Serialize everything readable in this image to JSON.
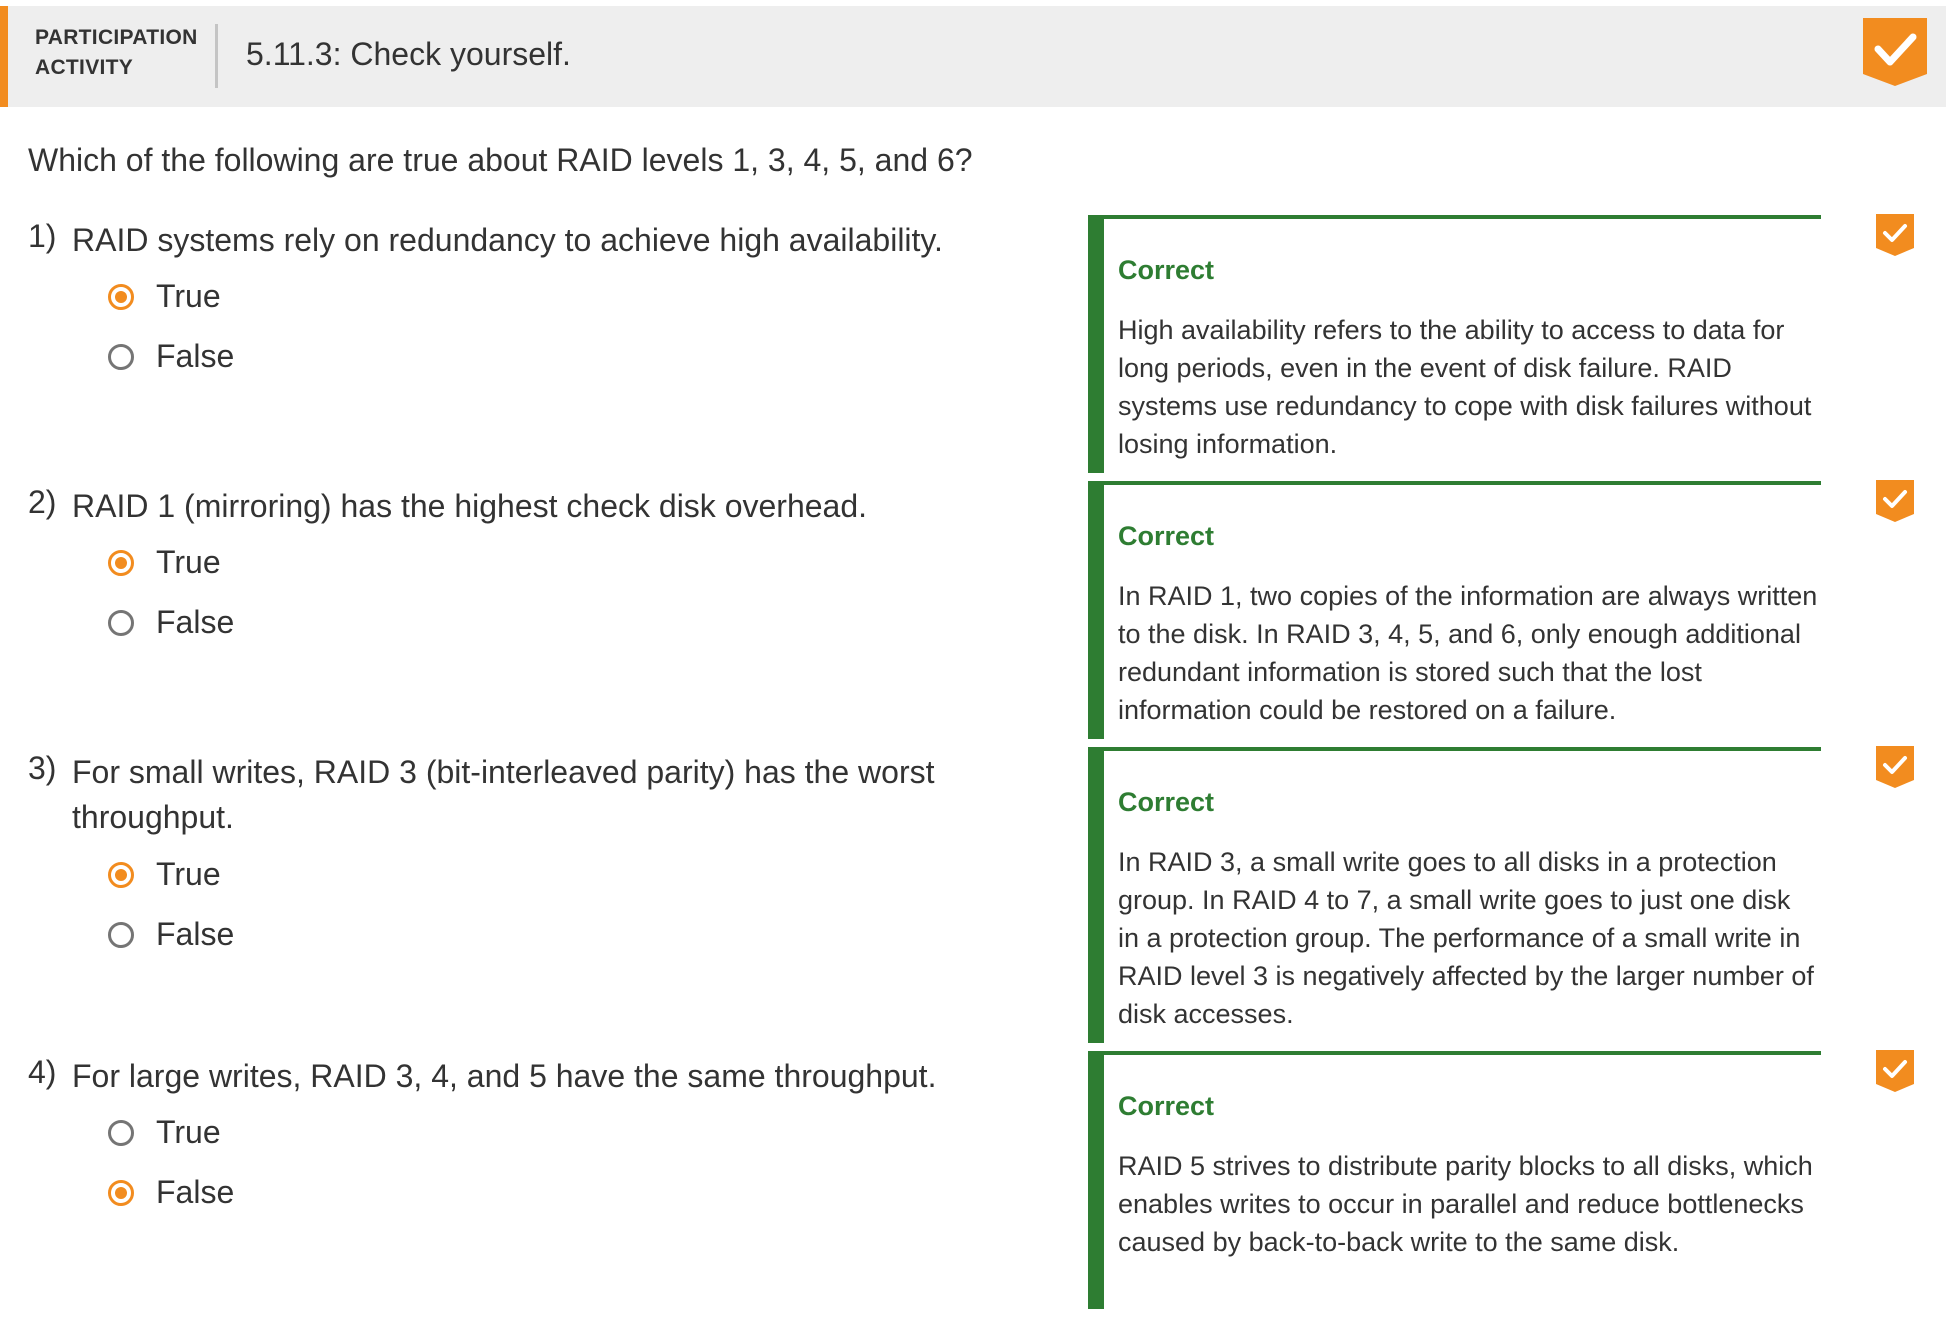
{
  "header": {
    "label_line1": "PARTICIPATION",
    "label_line2": "ACTIVITY",
    "title": "5.11.3: Check yourself.",
    "completion_icon": "checkmark-icon"
  },
  "prompt": "Which of the following are true about RAID levels 1, 3, 4, 5, and 6?",
  "colors": {
    "accent_orange": "#f28c1f",
    "correct_green": "#2e7d32",
    "header_bg": "#eeeeee"
  },
  "questions": [
    {
      "number": "1)",
      "text": "RAID systems rely on redundancy to achieve high availability.",
      "options": [
        {
          "label": "True",
          "selected": true
        },
        {
          "label": "False",
          "selected": false
        }
      ],
      "feedback": {
        "title": "Correct",
        "text": "High availability refers to the ability to access to data for long periods, even in the event of disk failure. RAID systems use redundancy to cope with disk failures without losing information."
      }
    },
    {
      "number": "2)",
      "text": "RAID 1 (mirroring) has the highest check disk overhead.",
      "options": [
        {
          "label": "True",
          "selected": true
        },
        {
          "label": "False",
          "selected": false
        }
      ],
      "feedback": {
        "title": "Correct",
        "text": "In RAID 1, two copies of the information are always written to the disk. In RAID 3, 4, 5, and 6, only enough additional redundant information is stored such that the lost information could be restored on a failure."
      }
    },
    {
      "number": "3)",
      "text": "For small writes, RAID 3 (bit-interleaved parity) has the worst throughput.",
      "options": [
        {
          "label": "True",
          "selected": true
        },
        {
          "label": "False",
          "selected": false
        }
      ],
      "feedback": {
        "title": "Correct",
        "text": "In RAID 3, a small write goes to all disks in a protection group. In RAID 4 to 7, a small write goes to just one disk in a protection group. The performance of a small write in RAID level 3 is negatively affected by the larger number of disk accesses."
      }
    },
    {
      "number": "4)",
      "text": "For large writes, RAID 3, 4, and 5 have the same throughput.",
      "options": [
        {
          "label": "True",
          "selected": false
        },
        {
          "label": "False",
          "selected": true
        }
      ],
      "feedback": {
        "title": "Correct",
        "text": "RAID 5 strives to distribute parity blocks to all disks, which enables writes to occur in parallel and reduce bottlenecks caused by back-to-back write to the same disk."
      }
    }
  ]
}
